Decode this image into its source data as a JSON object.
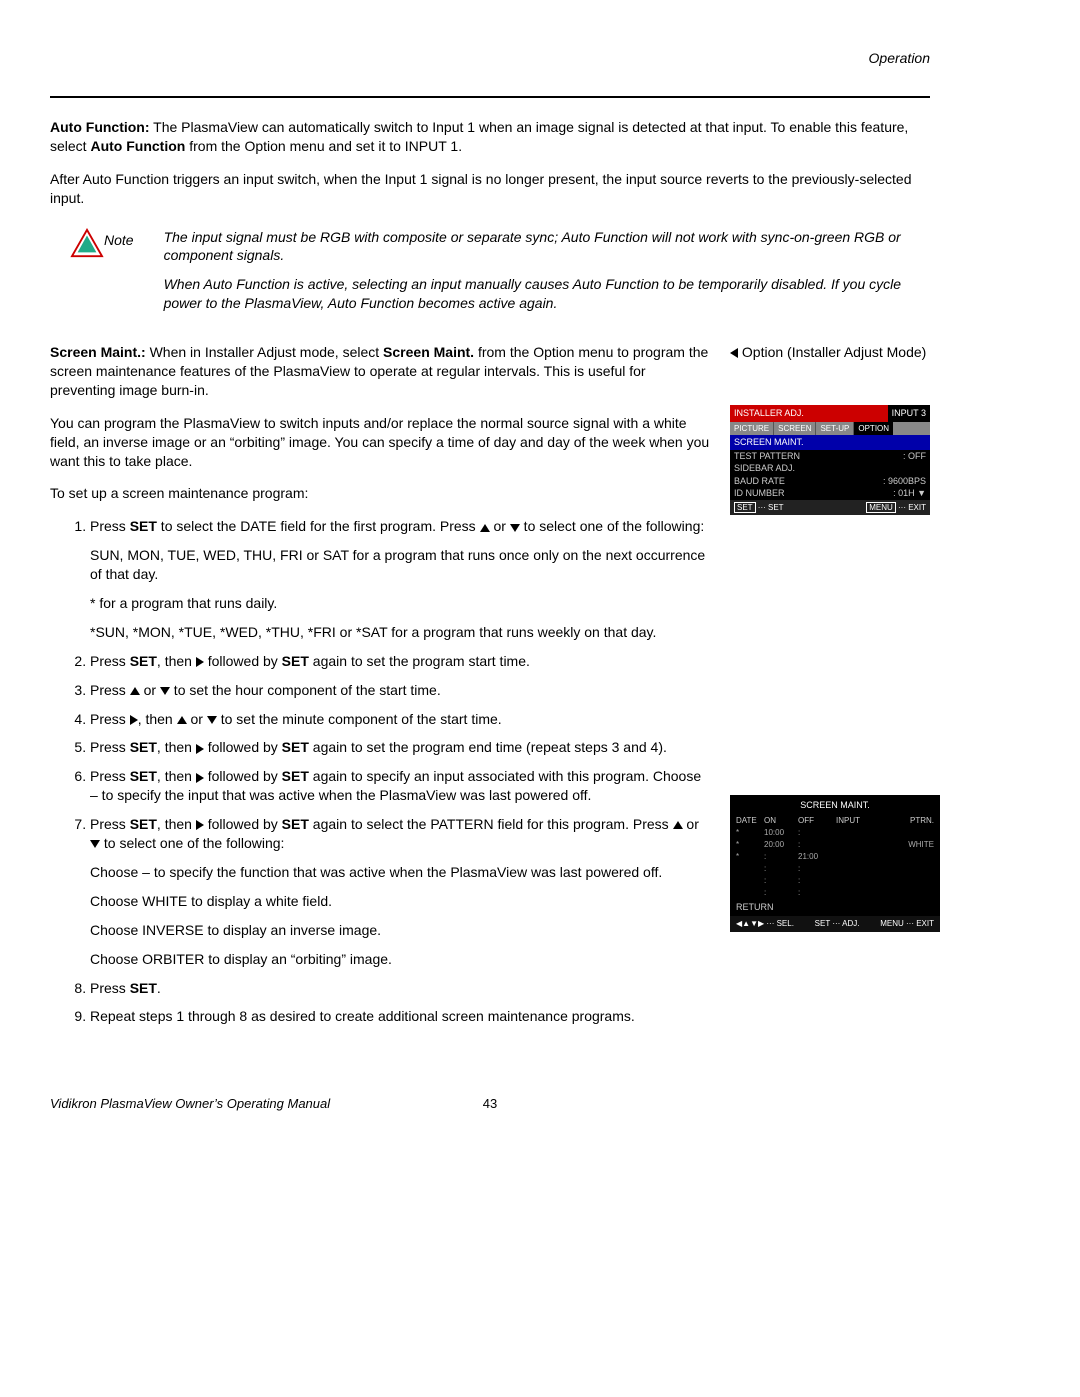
{
  "header": {
    "section": "Operation"
  },
  "autofunc": {
    "label": "Auto Function:",
    "p1a": " The PlasmaView can automatically switch to Input 1 when an image signal is detected at that input. To enable this feature, select ",
    "bold1": "Auto Function",
    "p1b": " from the Option menu and set it to INPUT 1.",
    "p2": "After Auto Function triggers an input switch, when the Input 1 signal is no longer present, the input source reverts to the previously-selected input."
  },
  "note": {
    "label": "Note",
    "p1": "The input signal must be RGB with composite or separate sync; Auto Function will not work with sync-on-green RGB or component signals.",
    "p2": "When Auto Function is active, selecting an input manually causes Auto Function to be temporarily disabled. If you cycle power to the PlasmaView, Auto Function becomes active again."
  },
  "screenmaint": {
    "label": "Screen Maint.:",
    "p1a": " When in Installer Adjust mode, select ",
    "bold1": "Screen Maint.",
    "p1b": " from the Option menu to program the screen maintenance features of the PlasmaView to operate at regular intervals. This is useful for preventing image burn-in.",
    "p2": "You can program the PlasmaView to switch inputs and/or replace the normal source signal with a white field, an inverse image or an “orbiting” image. You can specify a time of day and day of the week when you want this to take place.",
    "p3": "To set up a screen maintenance program:"
  },
  "steps": {
    "s1a": "Press ",
    "set": "SET",
    "s1b": " to select the DATE field for the first program. Press ",
    "s1c": " or ",
    "s1d": " to select one of the following:",
    "s1sub1": "SUN, MON, TUE, WED, THU, FRI or SAT for a program that runs once only on the next occurrence of that day.",
    "s1sub2": "* for a program that runs daily.",
    "s1sub3": "*SUN, *MON, *TUE, *WED, *THU, *FRI or *SAT for a program that runs weekly on that day.",
    "s2a": "Press ",
    "s2b": ", then ",
    "s2c": " followed by ",
    "s2d": " again to set the program start time.",
    "s3a": "Press ",
    "s3b": " or ",
    "s3c": " to set the hour component of the start time.",
    "s4a": "Press ",
    "s4b": ", then ",
    "s4c": " or ",
    "s4d": " to set the minute component of the start time.",
    "s5a": "Press ",
    "s5b": ", then ",
    "s5c": " followed by ",
    "s5d": " again to set the program end time (repeat steps 3 and 4).",
    "s6a": "Press ",
    "s6b": ", then ",
    "s6c": " followed by ",
    "s6d": " again to specify an input associated with this program. Choose – to specify the input that was active when the PlasmaView was last powered off.",
    "s7a": "Press ",
    "s7b": ", then ",
    "s7c": " followed by ",
    "s7d": " again to select the PATTERN field for this program. Press ",
    "s7e": " or ",
    "s7f": " to select one of the following:",
    "s7sub1": "Choose – to specify the function that was active when the PlasmaView was last powered off.",
    "s7sub2": "Choose WHITE to display a white field.",
    "s7sub3": "Choose INVERSE to display an inverse image.",
    "s7sub4": "Choose ORBITER to display an “orbiting” image.",
    "s8a": "Press ",
    "s8b": ".",
    "s9": "Repeat steps 1 through 8 as desired to create additional screen maintenance programs."
  },
  "right": {
    "heading": "Option (Installer Adjust Mode)"
  },
  "osd1": {
    "title": "INSTALLER ADJ.",
    "input": "INPUT 3",
    "tab1": "PICTURE",
    "tab2": "SCREEN",
    "tab3": "SET-UP",
    "tab4": "OPTION",
    "item1": "SCREEN MAINT.",
    "item2": "TEST PATTERN",
    "item2v": ":  OFF",
    "item3": "SIDEBAR ADJ.",
    "item4": "BAUD RATE",
    "item4v": ":  9600BPS",
    "item5": "ID NUMBER",
    "item5v": ":  01H     ▼",
    "foot_set": "SET",
    "foot_set2": "··· SET",
    "foot_menu": "MENU",
    "foot_exit": "··· EXIT"
  },
  "osd2": {
    "title": "SCREEN MAINT.",
    "h1": "DATE",
    "h2": "ON",
    "h3": "OFF",
    "h4": "INPUT",
    "h5": "PTRN.",
    "r1": [
      "*",
      "10:00",
      ":",
      "",
      ""
    ],
    "r2": [
      "*",
      "20:00",
      ":",
      "",
      "WHITE"
    ],
    "r3": [
      "*",
      ":",
      "21:00",
      "",
      ""
    ],
    "r4": [
      "",
      ":",
      ":",
      "",
      ""
    ],
    "r5": [
      "",
      ":",
      ":",
      "",
      ""
    ],
    "r6": [
      "",
      ":",
      ":",
      "",
      ""
    ],
    "return": "RETURN",
    "foot_sel": "◀▲▼▶ ··· SEL.",
    "foot_set": "SET",
    "foot_adj": "··· ADJ.",
    "foot_menu": "MENU",
    "foot_exit": "··· EXIT"
  },
  "footer": {
    "left": "Vidikron PlasmaView Owner’s Operating Manual",
    "page": "43"
  }
}
